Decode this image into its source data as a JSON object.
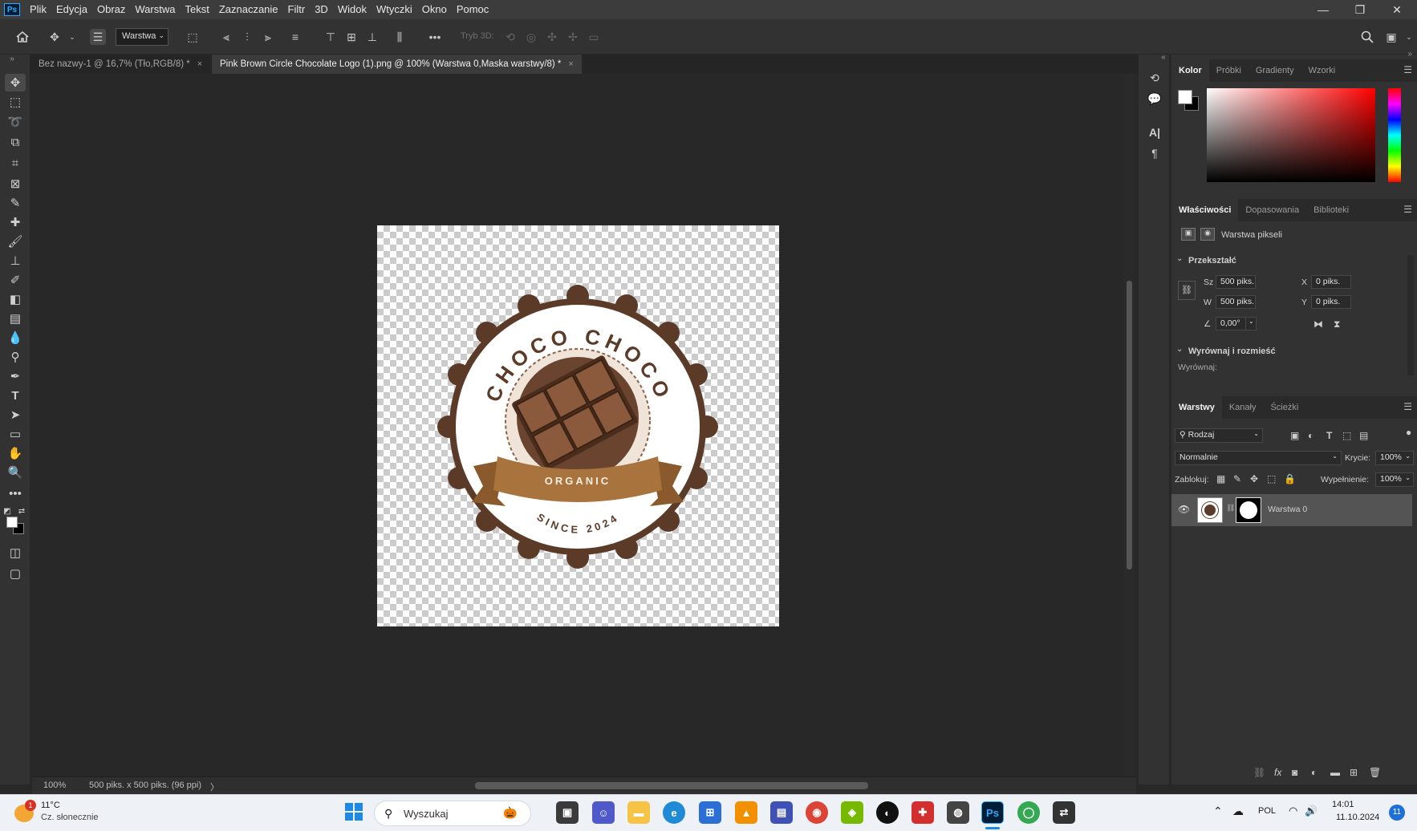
{
  "app": {
    "logo": "Ps"
  },
  "menu": [
    "Plik",
    "Edycja",
    "Obraz",
    "Warstwa",
    "Tekst",
    "Zaznaczanie",
    "Filtr",
    "3D",
    "Widok",
    "Wtyczki",
    "Okno",
    "Pomoc"
  ],
  "options": {
    "layer_select": "Warstwa",
    "mode3d": "Tryb 3D:"
  },
  "tabs": [
    {
      "label": "Bez nazwy-1 @ 16,7% (Tło,RGB/8) *",
      "close": "×"
    },
    {
      "label": "Pink Brown Circle Chocolate Logo (1).png @ 100% (Warstwa 0,Maska warstwy/8) *",
      "close": "×"
    }
  ],
  "logo_text": {
    "top": "CHOCO CHOCO",
    "ribbon": "ORGANIC",
    "bottom": "SINCE 2024"
  },
  "status": {
    "zoom": "100%",
    "doc_info": "500 piks. x 500 piks. (96 ppi)",
    "arrow": "〉"
  },
  "color_panel": {
    "tabs": [
      "Kolor",
      "Próbki",
      "Gradienty",
      "Wzorki"
    ],
    "active": "Kolor"
  },
  "properties_panel": {
    "tabs": [
      "Właściwości",
      "Dopasowania",
      "Biblioteki"
    ],
    "layer_type": "Warstwa pikseli",
    "transform_header": "Przekształć",
    "w_label": "Sz",
    "w_value": "500 piks.",
    "h_label": "W",
    "h_value": "500 piks.",
    "x_label": "X",
    "x_value": "0 piks.",
    "y_label": "Y",
    "y_value": "0 piks.",
    "angle": "0,00°",
    "align_header": "Wyrównaj i rozmieść",
    "align_label": "Wyrównaj:"
  },
  "layers_panel": {
    "tabs": [
      "Warstwy",
      "Kanały",
      "Ścieżki"
    ],
    "filter": "Rodzaj",
    "blend_mode": "Normalnie",
    "opacity_label": "Krycie:",
    "opacity": "100%",
    "lock_label": "Zablokuj:",
    "fill_label": "Wypełnienie:",
    "fill": "100%",
    "layer_name": "Warstwa 0"
  },
  "taskbar": {
    "weather_temp": "11°C",
    "weather_desc": "Cz. słonecznie",
    "weather_badge": "1",
    "search_placeholder": "Wyszukaj",
    "lang": "POL",
    "time": "14:01",
    "date": "11.10.2024",
    "notif_count": "11"
  },
  "colors": {
    "accent_blue": "#31a8ff",
    "chocolate": "#5b3b28",
    "ribbon": "#a8733d"
  }
}
